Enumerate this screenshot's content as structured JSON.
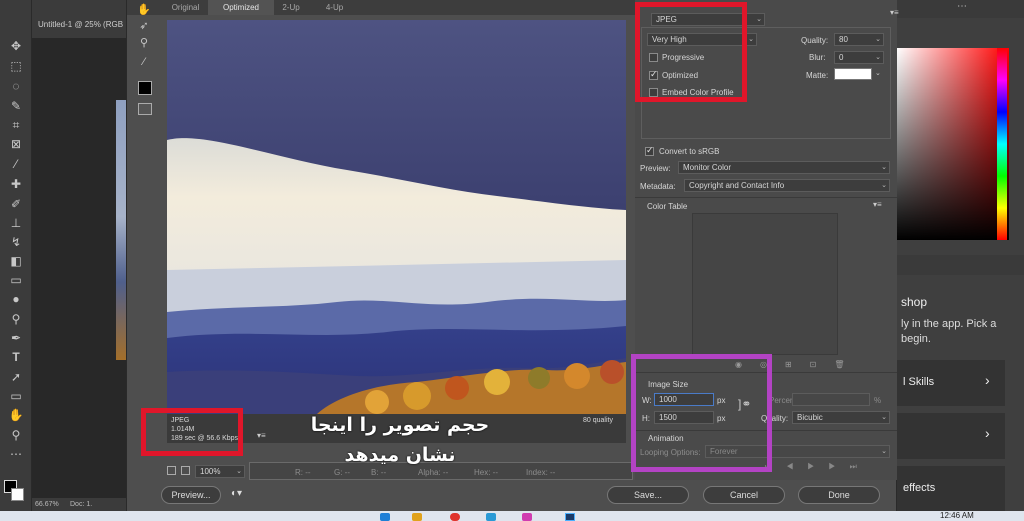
{
  "photoshop": {
    "doc_tab": "Untitled-1 @ 25% (RGB",
    "zoom_status": "66.67%",
    "doc_status": "Doc: 1.",
    "right_panel": {
      "heading": "shop",
      "line1": "ly in the app. Pick a",
      "line2": "begin.",
      "card1": "l Skills",
      "card3": "effects"
    },
    "clock": "12:46 AM"
  },
  "dialog": {
    "tabs": [
      "Original",
      "Optimized",
      "2-Up",
      "4-Up"
    ],
    "active_tab": "Optimized",
    "preview_info": {
      "format": "JPEG",
      "size": "1.014M",
      "time": "189 sec @ 56.6 Kbps",
      "quality_note": "80 quality"
    },
    "zoom": "100%",
    "readouts": {
      "r": "R: --",
      "g": "G: --",
      "b": "B: --",
      "alpha": "Alpha: --",
      "hex": "Hex: --",
      "index": "Index: --"
    },
    "buttons": {
      "preview": "Preview...",
      "save": "Save...",
      "cancel": "Cancel",
      "done": "Done"
    },
    "settings": {
      "format": "JPEG",
      "quality_preset": "Very High",
      "quality_label": "Quality:",
      "quality_value": "80",
      "progressive": "Progressive",
      "progressive_checked": false,
      "optimized": "Optimized",
      "optimized_checked": true,
      "blur_label": "Blur:",
      "blur_value": "0",
      "embed": "Embed Color Profile",
      "matte_label": "Matte:",
      "convert": "Convert to sRGB",
      "convert_checked": true,
      "preview_label": "Preview:",
      "preview_value": "Monitor Color",
      "metadata_label": "Metadata:",
      "metadata_value": "Copyright and Contact Info"
    },
    "color_table": {
      "title": "Color Table"
    },
    "image_size": {
      "title": "Image Size",
      "w_label": "W:",
      "w_value": "1000",
      "h_label": "H:",
      "h_value": "1500",
      "unit": "px",
      "percent_label": "Percent:",
      "percent_unit": "%",
      "quality_label": "Quality:",
      "quality_value": "Bicubic"
    },
    "animation": {
      "title": "Animation",
      "looping_label": "Looping Options:",
      "looping_value": "Forever"
    }
  },
  "annotation_text": {
    "line1": "حجم تصویر را اینجا",
    "line2": "نشان میدهد"
  },
  "colors": {
    "highlight_red": "#e0162a",
    "highlight_purple": "#b343c4"
  }
}
